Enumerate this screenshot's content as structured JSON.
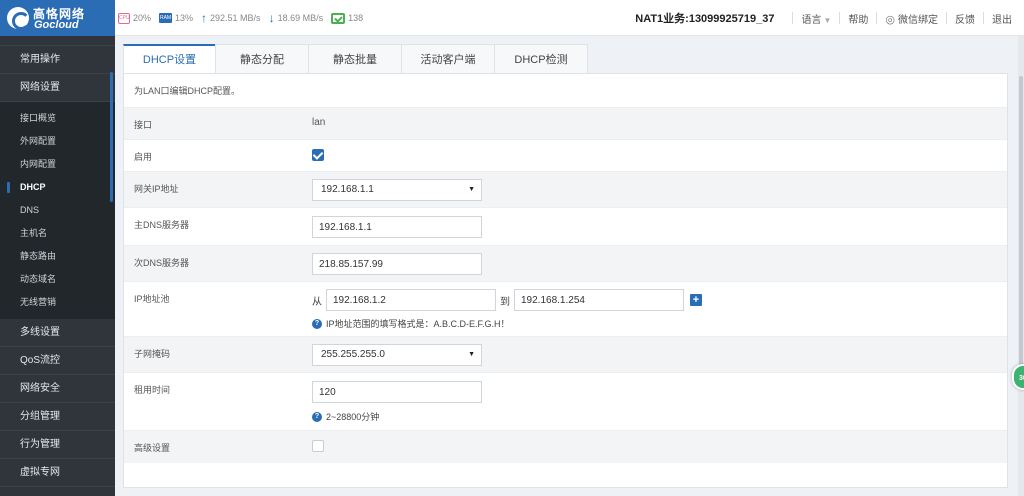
{
  "brand": {
    "name_cn": "高恪网络",
    "name_en": "Gocloud"
  },
  "status": {
    "cpu_icon": "CPU",
    "cpu": "20%",
    "ram_icon": "RAM",
    "ram": "13%",
    "upload": "292.51 MB/s",
    "download": "18.69 MB/s",
    "connections": "138"
  },
  "header": {
    "account": "NAT1业务:13099925719_37",
    "language": "语言",
    "help": "帮助",
    "wechat": "微信绑定",
    "feedback": "反馈",
    "logout": "退出"
  },
  "sidebar": {
    "top_items": [
      {
        "label": "常用操作"
      },
      {
        "label": "网络设置"
      }
    ],
    "sub_items": [
      {
        "label": "接口概览"
      },
      {
        "label": "外网配置"
      },
      {
        "label": "内网配置"
      },
      {
        "label": "DHCP"
      },
      {
        "label": "DNS"
      },
      {
        "label": "主机名"
      },
      {
        "label": "静态路由"
      },
      {
        "label": "动态域名"
      },
      {
        "label": "无线营销"
      }
    ],
    "bottom_items": [
      {
        "label": "多线设置"
      },
      {
        "label": "QoS流控"
      },
      {
        "label": "网络安全"
      },
      {
        "label": "分组管理"
      },
      {
        "label": "行为管理"
      },
      {
        "label": "虚拟专网"
      }
    ]
  },
  "tabs": [
    {
      "label": "DHCP设置"
    },
    {
      "label": "静态分配"
    },
    {
      "label": "静态批量"
    },
    {
      "label": "活动客户端"
    },
    {
      "label": "DHCP检测"
    }
  ],
  "form": {
    "description": "为LAN口编辑DHCP配置。",
    "interface": {
      "label": "接口",
      "value": "lan"
    },
    "enable": {
      "label": "启用",
      "checked": true
    },
    "gateway": {
      "label": "网关IP地址",
      "value": "192.168.1.1"
    },
    "dns_primary": {
      "label": "主DNS服务器",
      "value": "192.168.1.1"
    },
    "dns_secondary": {
      "label": "次DNS服务器",
      "value": "218.85.157.99"
    },
    "ip_pool": {
      "label": "IP地址池",
      "from_label": "从",
      "start": "192.168.1.2",
      "to_label": "到",
      "end": "192.168.1.254",
      "hint": "IP地址范围的填写格式是：A.B.C.D-E.F.G.H！"
    },
    "netmask": {
      "label": "子网掩码",
      "value": "255.255.255.0"
    },
    "lease": {
      "label": "租用时间",
      "value": "120",
      "hint": "2~28800分钟"
    },
    "advanced": {
      "label": "高级设置",
      "checked": false
    }
  },
  "float_ball": "30"
}
